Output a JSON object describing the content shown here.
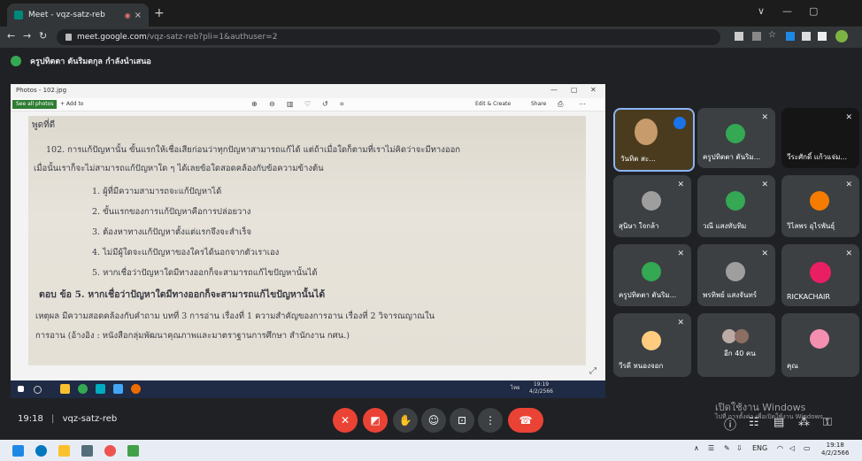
{
  "browser": {
    "tab_title": "Meet - vqz-satz-reb",
    "tab_rec": "◉",
    "tab_close": "×",
    "new_tab": "+",
    "url_host": "meet.google.com",
    "url_path": "/vqz-satz-reb?pli=1&authuser=2",
    "win_min": "—",
    "win_max": "▢",
    "win_chev": "∨"
  },
  "meet": {
    "presenter_text": "ครูปทิตตา ตันริมตกุล กำลังนำเสนอ",
    "meeting_time": "19:18",
    "meeting_code": "vqz-satz-reb"
  },
  "photos": {
    "title": "Photos - 102.jpg",
    "see_all": "See all photos",
    "add_to": "+ Add to",
    "edit_create": "Edit & Create",
    "share": "Share",
    "lines": [
      "พูดที่ดี",
      "102. การแก้ปัญหานั้น ขั้นแรกให้เชื่อเสียก่อนว่าทุกปัญหาสามารถแก้ได้ แต่ถ้าเมื่อใดก็ตามที่เราไม่คิดว่าจะมีทางออก",
      "เมื่อนั้นเราก็จะไม่สามารถแก้ปัญหาใด ๆ ได้เลยข้อใดสอดคล้องกับข้อความข้างต้น",
      "1. ผู้ที่มีความสามารถจะแก้ปัญหาได้",
      "2. ขั้นแรกของการแก้ปัญหาคือการปล่อยวาง",
      "3. ต้องหาทางแก้ปัญหาตั้งแต่แรกจึงจะสำเร็จ",
      "4. ไม่มีผู้ใดจะแก้ปัญหาของใครได้นอกจากตัวเราเอง",
      "5. หากเชื่อว่าปัญหาใดมีทางออกก็จะสามารถแก้ไขปัญหานั้นได้",
      "ตอบ  ข้อ 5. หากเชื่อว่าปัญหาใดมีทางออกก็จะสามารถแก้ไขปัญหานั้นได้",
      "เหตุผล มีความสอดคล้องกับคำถาม บทที่ 3 การอ่าน   เรื่องที่ 1 ความสำคัญของการอาน  เรื่องที่ 2 วิจารณญาณใน",
      "การอาน  (อ้างอิง : หนังสือกลุ่มพัฒนาคุณภาพและมาตราฐานการศึกษา สำนักงาน กศน.)"
    ],
    "inner_clock_time": "19:19",
    "inner_clock_date": "4/2/2566",
    "inner_lang": "ไทย"
  },
  "participants": [
    {
      "name": "วันทิต สะ...",
      "muted": false
    },
    {
      "name": "ครูปทิตตา ตันริม...",
      "muted": true
    },
    {
      "name": "วีระศักดิ์ แก้วแจ่ม...",
      "muted": true
    },
    {
      "name": "สุนิษา ใจกล้า",
      "muted": true
    },
    {
      "name": "วณี แสงทับทิม",
      "muted": true
    },
    {
      "name": "วิไลพร อุไรพันธุ์",
      "muted": true
    },
    {
      "name": "ครูปทิตตา ตันริม...",
      "muted": true
    },
    {
      "name": "พรทิพย์ แสงจันทร์",
      "muted": true
    },
    {
      "name": "RICKACHAIR",
      "muted": true
    },
    {
      "name": "วีรดี หนองจอก",
      "muted": true
    },
    {
      "name": "อีก 40 คน",
      "muted": false
    },
    {
      "name": "คุณ",
      "muted": false
    }
  ],
  "windows_notice": {
    "line1": "เปิดใช้งาน Windows",
    "line2": "ไปที่ การตั้งค่า เพื่อเปิดใช้งาน Windows"
  },
  "taskbar": {
    "lang": "ENG",
    "time": "19:18",
    "date": "4/2/2566"
  },
  "colors": {
    "meet_bg": "#202124",
    "tile_bg": "#3c4043",
    "red": "#ea4335",
    "accent_blue": "#8ab4f8"
  }
}
